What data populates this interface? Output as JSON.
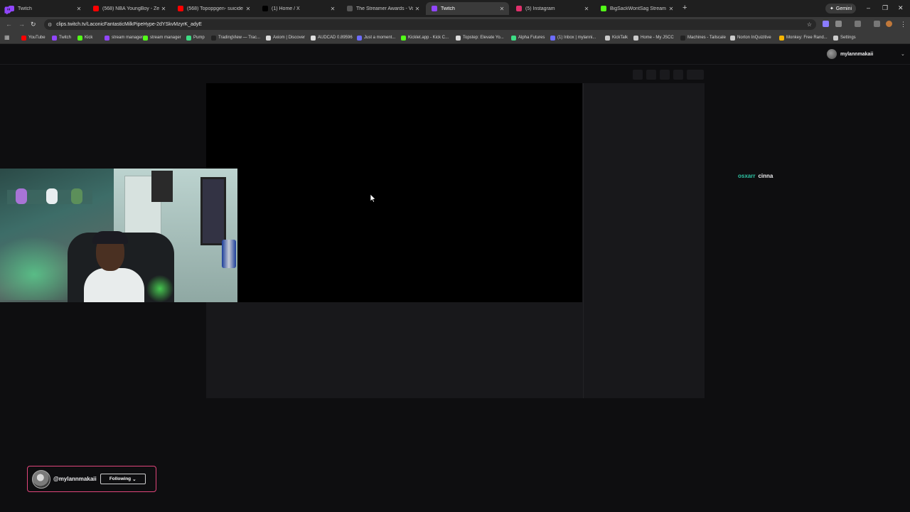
{
  "browser": {
    "tabs": [
      {
        "label": "Twitch",
        "color": "#9146ff"
      },
      {
        "label": "(568) NBA YoungBoy - Zero K",
        "color": "#ff0000"
      },
      {
        "label": "(568) Topoppgen- suicide song",
        "color": "#ff0000"
      },
      {
        "label": "(1) Home / X",
        "color": "#000000"
      },
      {
        "label": "The Streamer Awards - Vote",
        "color": "#555555"
      },
      {
        "label": "Twitch",
        "color": "#9146ff",
        "active": true
      },
      {
        "label": "(5) Instagram",
        "color": "#e1306c"
      },
      {
        "label": "BigSackWontSag Stream - Wa",
        "color": "#53fc18"
      }
    ],
    "new_tab_glyph": "+",
    "gemini_label": "Gemini",
    "window_controls": {
      "minimize": "–",
      "restore": "❐",
      "close": "✕"
    },
    "nav": {
      "back": "←",
      "forward": "→",
      "reload": "↻"
    },
    "url": "clips.twitch.tv/LaconicFantasticMilkPipeHype-2dYSkvMzyrK_adyE",
    "bookmarks": [
      {
        "label": "YouTube",
        "color": "#ff0000"
      },
      {
        "label": "Twitch",
        "color": "#9146ff"
      },
      {
        "label": "Kick",
        "color": "#53fc18"
      },
      {
        "label": "stream manager",
        "color": "#9146ff"
      },
      {
        "label": "stream manager",
        "color": "#53fc18"
      },
      {
        "label": "Pump",
        "color": "#3ddc84"
      },
      {
        "label": "TradingView — Trac...",
        "color": "#222222"
      },
      {
        "label": "Axiom | Discover",
        "color": "#dddddd"
      },
      {
        "label": "AUDCAD 0.89596",
        "color": "#dddddd"
      },
      {
        "label": "Just a moment...",
        "color": "#6c6cff"
      },
      {
        "label": "Kicklet.app - Kick C...",
        "color": "#53fc18"
      },
      {
        "label": "Topstep: Elevate Yo...",
        "color": "#dddddd"
      },
      {
        "label": "Alpha Futures",
        "color": "#3ddc84"
      },
      {
        "label": "(1) Inbox | mylanni...",
        "color": "#6c6cff"
      },
      {
        "label": "KickTalk",
        "color": "#cccccc"
      },
      {
        "label": "Home - My JSCC",
        "color": "#cccccc"
      },
      {
        "label": "Machines - Tailscale",
        "color": "#222222"
      },
      {
        "label": "Norton InQuizitive",
        "color": "#cccccc"
      },
      {
        "label": "Monkey: Free Rand...",
        "color": "#f4b400"
      },
      {
        "label": "Settings",
        "color": "#cccccc"
      }
    ]
  },
  "twitch": {
    "brand_color": "#9146ff",
    "username": "mylannmakaii",
    "chat": {
      "user": "osxarr",
      "message": "cinna",
      "user_color": "#2ec4a4"
    }
  },
  "follow_card": {
    "handle": "@mylannmakaii",
    "button_label": "Following",
    "button_chevron": "⌄",
    "border_color": "#e0457b"
  }
}
